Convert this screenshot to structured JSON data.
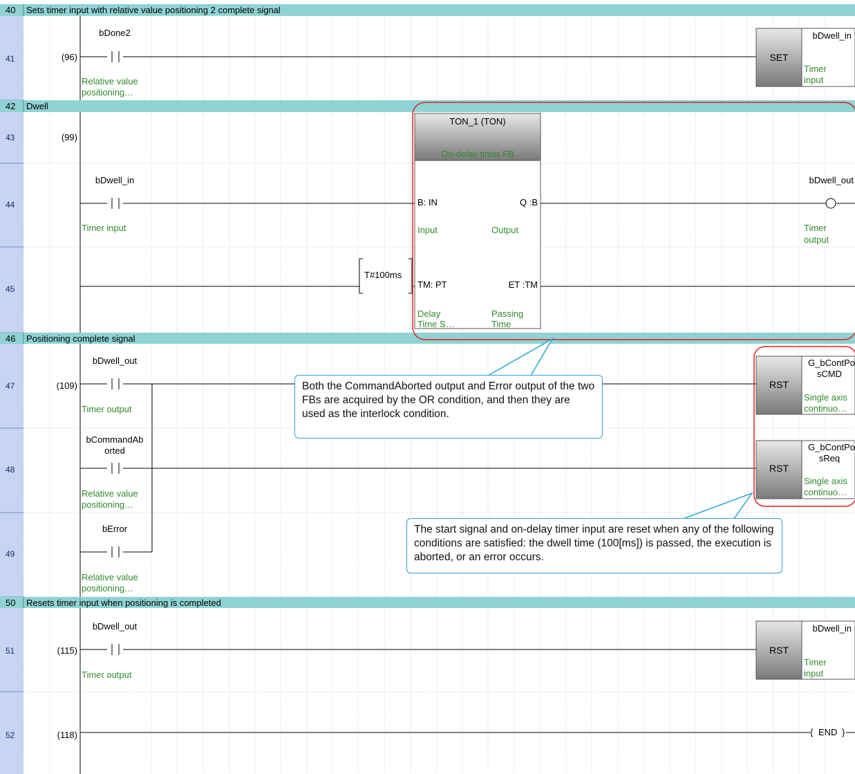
{
  "rows": [
    {
      "num": "40",
      "type": "comment",
      "text": "Sets timer input with relative value positioning 2 complete signal"
    },
    {
      "num": "41",
      "type": "ladder",
      "step": "(96)"
    },
    {
      "num": "42",
      "type": "comment",
      "text": "Dwell"
    },
    {
      "num": "43",
      "type": "ladder",
      "step": "(99)"
    },
    {
      "num": "44",
      "type": "ladder",
      "step": ""
    },
    {
      "num": "45",
      "type": "ladder",
      "step": ""
    },
    {
      "num": "46",
      "type": "comment",
      "text": "Positioning complete signal"
    },
    {
      "num": "47",
      "type": "ladder",
      "step": "(109)"
    },
    {
      "num": "48",
      "type": "ladder",
      "step": ""
    },
    {
      "num": "49",
      "type": "ladder",
      "step": ""
    },
    {
      "num": "50",
      "type": "comment",
      "text": "Resets timer input when positioning is completed"
    },
    {
      "num": "51",
      "type": "ladder",
      "step": "(115)"
    },
    {
      "num": "52",
      "type": "ladder",
      "step": "(118)"
    }
  ],
  "contacts": [
    {
      "label1": "bDone2",
      "label2": "",
      "comment1": "Relative value",
      "comment2": "positioning…"
    },
    {
      "label1": "bDwell_in",
      "label2": "",
      "comment1": "Timer input",
      "comment2": ""
    },
    {
      "label1": "bDwell_out",
      "label2": "",
      "comment1": "Timer output",
      "comment2": ""
    },
    {
      "label1": "bCommandAb",
      "label2": "orted",
      "comment1": "Relative value",
      "comment2": "positioning…"
    },
    {
      "label1": "bError",
      "label2": "",
      "comment1": "Relative value",
      "comment2": "positioning…"
    },
    {
      "label1": "bDwell_out",
      "label2": "",
      "comment1": "Timer output",
      "comment2": ""
    }
  ],
  "instructions": [
    {
      "name": "SET",
      "label1": "bDwell_in",
      "label2": "",
      "comment1": "Timer",
      "comment2": "input"
    },
    {
      "name": "RST",
      "label1": "G_bContPo",
      "label2": "sCMD",
      "comment1": "Single axis",
      "comment2": "continuo…"
    },
    {
      "name": "RST",
      "label1": "G_bContPo",
      "label2": "sReq",
      "comment1": "Single axis",
      "comment2": "continuo…"
    },
    {
      "name": "RST",
      "label1": "bDwell_in",
      "label2": "",
      "comment1": "Timer",
      "comment2": "input"
    }
  ],
  "fb": {
    "title": "TON_1  (TON)",
    "comment": "On-delay timer FB",
    "in1": "B: IN",
    "in1_comment": "Input",
    "out1": "Q :B",
    "out1_comment": "Output",
    "in2": "TM: PT",
    "in2_comment1": "Delay",
    "in2_comment2": "Time S…",
    "out2": "ET :TM",
    "out2_comment1": "Passing",
    "out2_comment2": "Time",
    "preset": "T#100ms"
  },
  "coil": {
    "label": "bDwell_out",
    "comment1": "Timer",
    "comment2": "output"
  },
  "end_instruction": "END",
  "callouts": [
    "Both the CommandAborted output and Error output of the two FBs are acquired by the OR condition, and then they are used as the interlock condition.",
    "The start signal and on-delay timer input are reset when any of the following conditions are satisfied: the dwell time (100[ms]) is passed, the execution is aborted, or an error occurs."
  ],
  "colors": {
    "comment_bar": "#8fd3d3",
    "row_header": "#c8d4f4",
    "row_header_text": "#1a2a66",
    "device_comment": "#2e8b2e",
    "highlight": "#e02020",
    "callout_border": "#2aa3d6"
  }
}
